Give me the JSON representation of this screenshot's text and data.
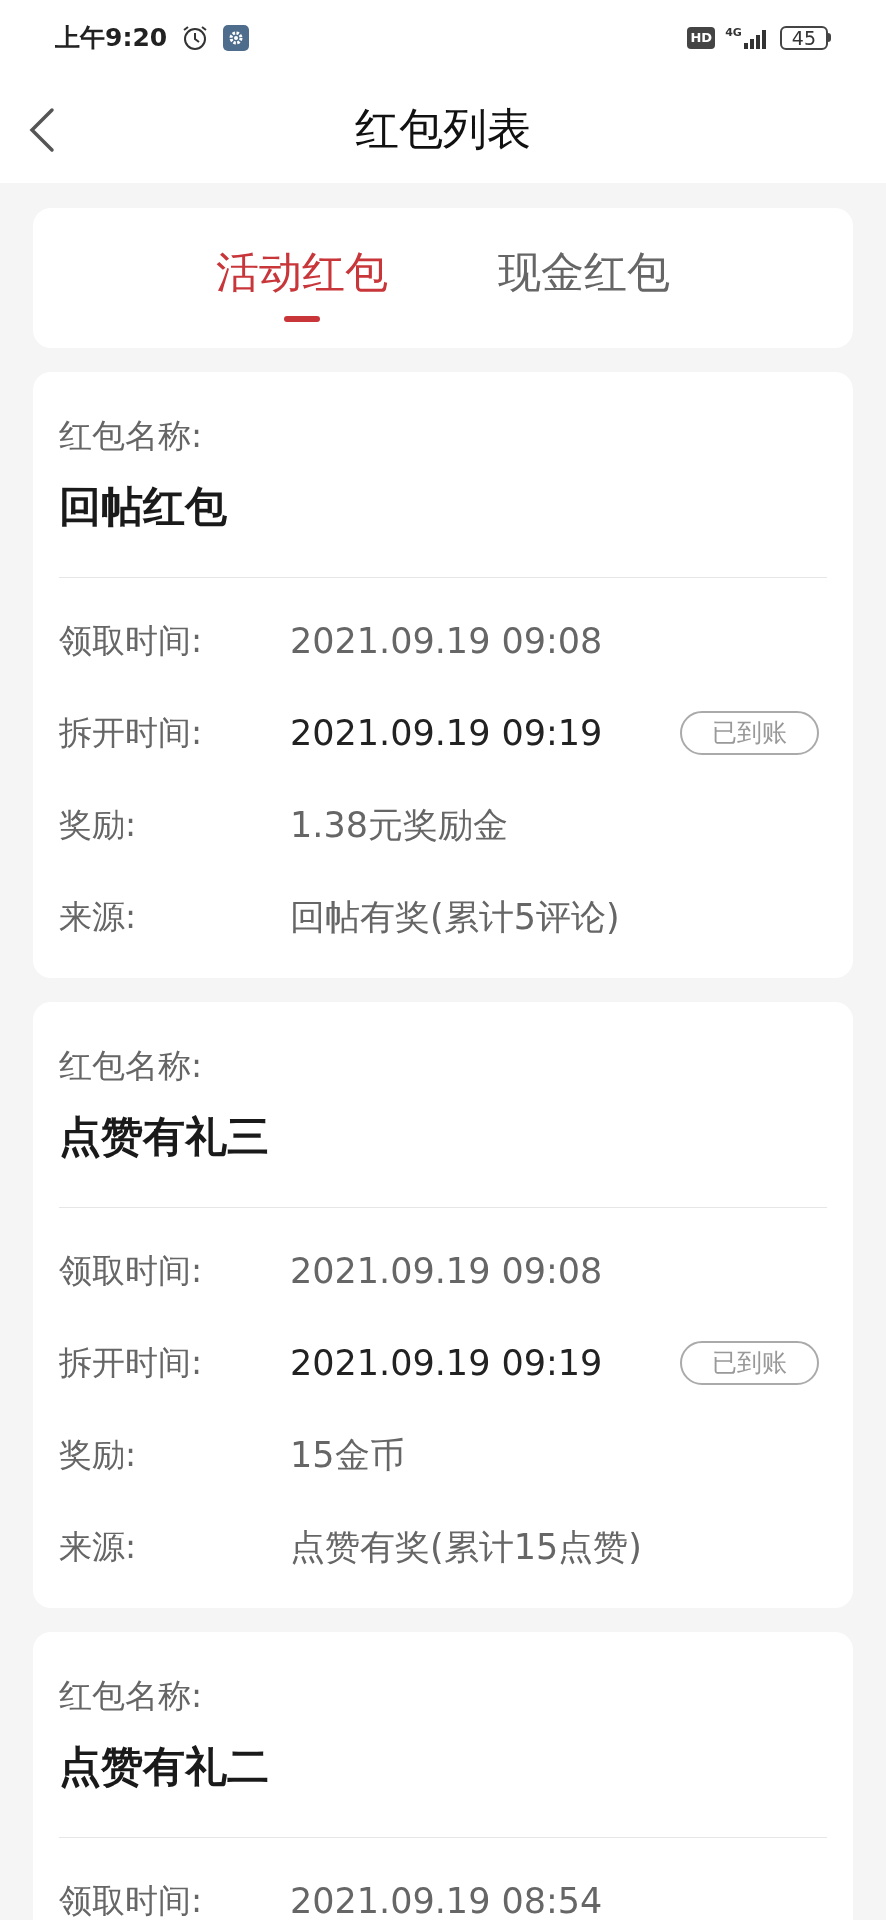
{
  "status_bar": {
    "time": "上午9:20",
    "hd": "HD",
    "network": "4G",
    "battery": "45"
  },
  "nav": {
    "title": "红包列表"
  },
  "tabs": [
    {
      "label": "活动红包",
      "selected": true
    },
    {
      "label": "现金红包",
      "selected": false
    }
  ],
  "cards": [
    {
      "name_label": "红包名称:",
      "name": "回帖红包",
      "rows": [
        {
          "label": "领取时间:",
          "value": "2021.09.19 09:08",
          "emphasis": false
        },
        {
          "label": "拆开时间:",
          "value": "2021.09.19 09:19",
          "emphasis": true,
          "badge": "已到账"
        },
        {
          "label": "奖励:",
          "value": "1.38元奖励金",
          "emphasis": false
        },
        {
          "label": "来源:",
          "value": "回帖有奖(累计5评论)",
          "emphasis": false
        }
      ]
    },
    {
      "name_label": "红包名称:",
      "name": "点赞有礼三",
      "rows": [
        {
          "label": "领取时间:",
          "value": "2021.09.19 09:08",
          "emphasis": false
        },
        {
          "label": "拆开时间:",
          "value": "2021.09.19 09:19",
          "emphasis": true,
          "badge": "已到账"
        },
        {
          "label": "奖励:",
          "value": "15金币",
          "emphasis": false
        },
        {
          "label": "来源:",
          "value": "点赞有奖(累计15点赞)",
          "emphasis": false
        }
      ]
    },
    {
      "name_label": "红包名称:",
      "name": "点赞有礼二",
      "rows": [
        {
          "label": "领取时间:",
          "value": "2021.09.19 08:54",
          "emphasis": false
        }
      ]
    }
  ]
}
